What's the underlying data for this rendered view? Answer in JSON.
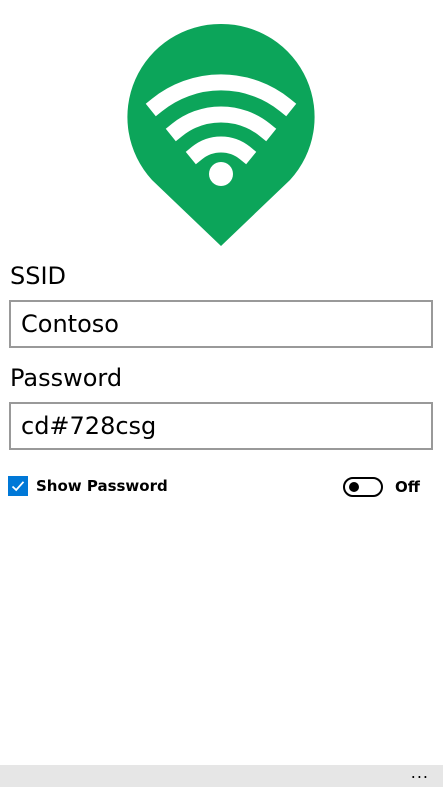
{
  "colors": {
    "brand": "#0ca55a",
    "accent": "#0078d7",
    "input_border": "#999999",
    "app_bar": "#e6e6e6"
  },
  "logo": {
    "icon": "wifi-location-pin-icon"
  },
  "form": {
    "ssid_label": "SSID",
    "ssid_value": "Contoso",
    "password_label": "Password",
    "password_value": "cd#728csg"
  },
  "show_password": {
    "label": "Show Password",
    "checked": true
  },
  "toggle": {
    "state_label": "Off",
    "on": false
  },
  "app_bar": {
    "more_label": "..."
  }
}
